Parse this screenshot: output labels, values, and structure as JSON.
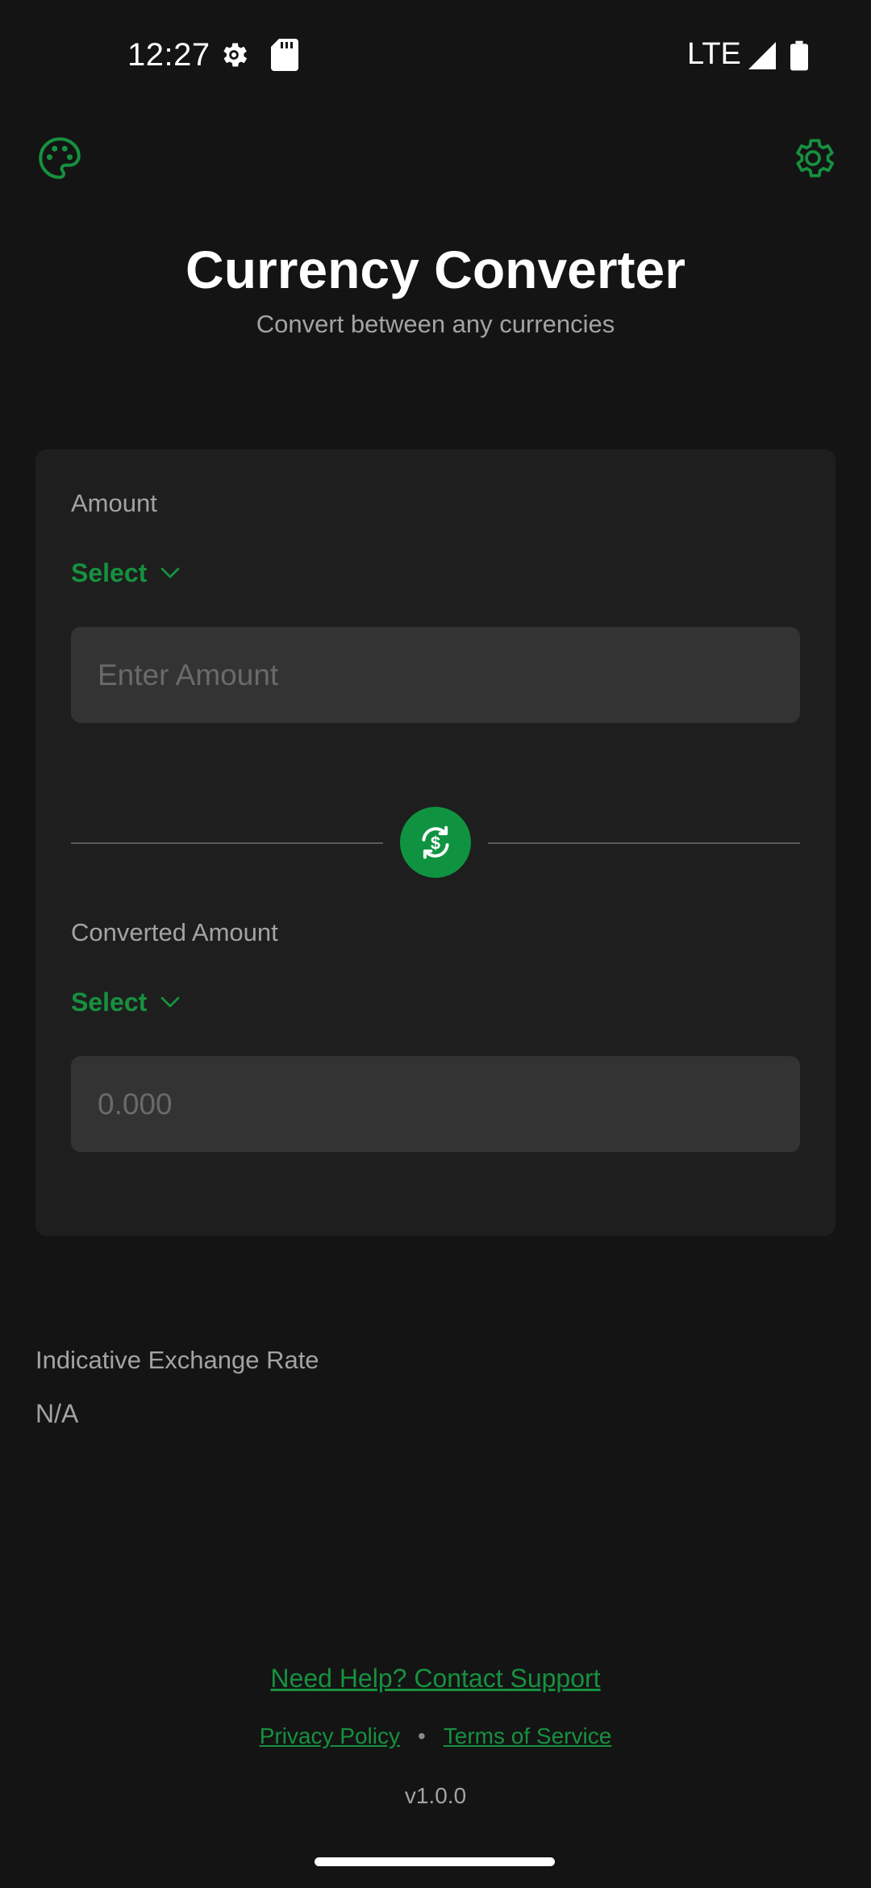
{
  "status_bar": {
    "time": "12:27",
    "network": "LTE",
    "icons": [
      "settings-gear-icon",
      "sd-card-icon",
      "signal-icon",
      "battery-icon"
    ]
  },
  "toolbar": {
    "theme_icon": "palette-icon",
    "settings_icon": "gear-icon"
  },
  "header": {
    "title": "Currency Converter",
    "subtitle": "Convert between any currencies"
  },
  "converter": {
    "from": {
      "label": "Amount",
      "currency_label": "Select",
      "input_value": "",
      "input_placeholder": "Enter Amount"
    },
    "to": {
      "label": "Converted Amount",
      "currency_label": "Select",
      "input_value": "",
      "input_placeholder": "0.000"
    },
    "swap_icon": "currency-swap-icon"
  },
  "exchange_rate": {
    "label": "Indicative Exchange Rate",
    "value": "N/A"
  },
  "footer": {
    "support_link": "Need Help? Contact Support",
    "privacy_link": "Privacy Policy",
    "separator": "•",
    "terms_link": "Terms of Service",
    "version": "v1.0.0"
  },
  "colors": {
    "background": "#141414",
    "card": "#1e1e1e",
    "input": "#333333",
    "accent": "#16913f",
    "swap_button": "#0f9341",
    "text_primary": "#ffffff",
    "text_secondary": "#a3a3a3"
  }
}
